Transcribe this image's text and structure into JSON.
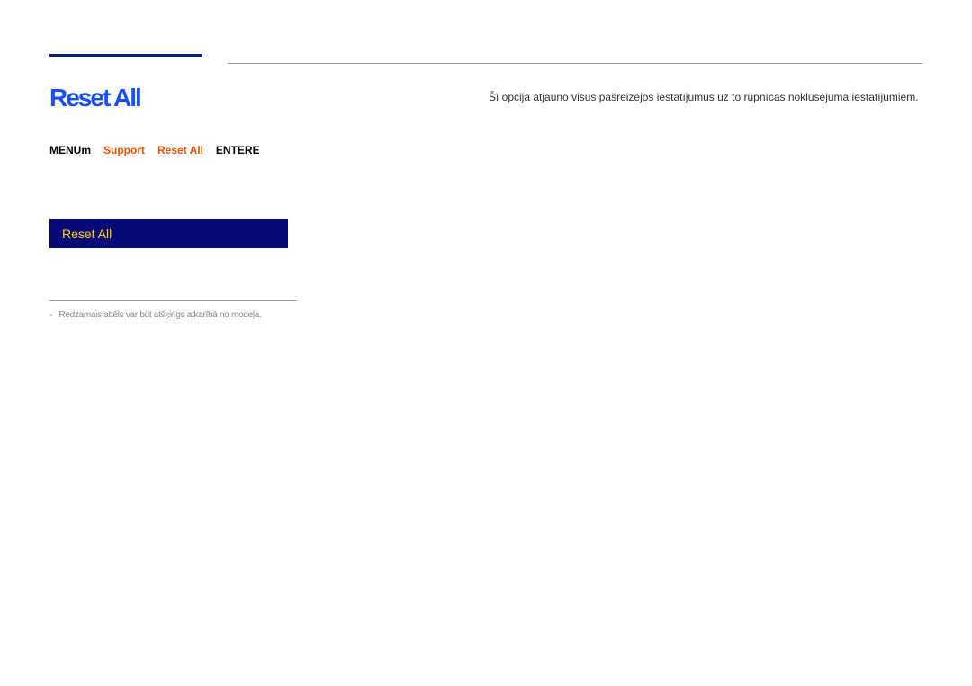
{
  "title": "Reset All",
  "breadcrumb": {
    "menu": "MENU",
    "m_suffix": "m",
    "support": "Support",
    "reset": "Reset All",
    "enter": "ENTER",
    "e_suffix": "E"
  },
  "menu": {
    "reset_all": "Reset All"
  },
  "footnote": "Redzamais attēls var būt atšķirīgs atkarībā no modeļa.",
  "description": "Šī opcija atjauno visus pašreizējos iestatījumus uz to rūpnīcas noklusējuma iestatījumiem."
}
